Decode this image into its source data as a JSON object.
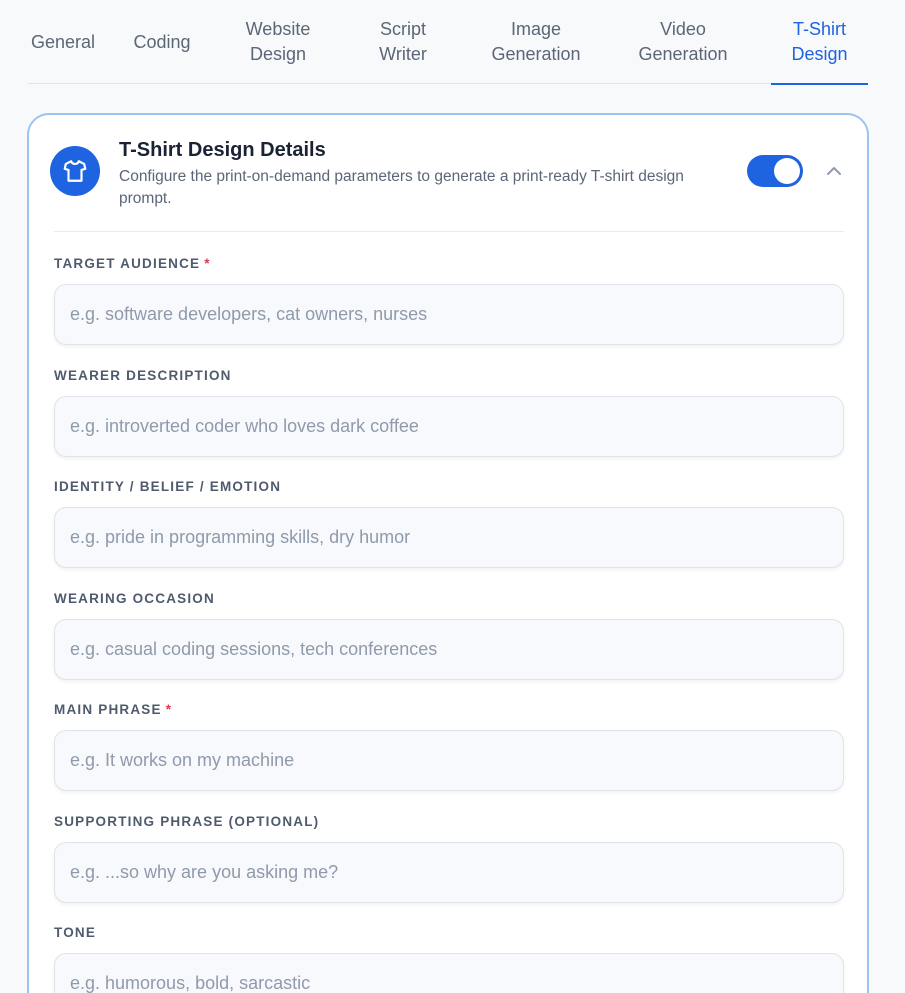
{
  "tabs": [
    {
      "label": "General"
    },
    {
      "label": "Coding"
    },
    {
      "label": "Website Design"
    },
    {
      "label": "Script Writer"
    },
    {
      "label": "Image Generation"
    },
    {
      "label": "Video Generation"
    },
    {
      "label": "T-Shirt Design",
      "active": true
    }
  ],
  "card": {
    "icon": "tshirt-icon",
    "title": "T-Shirt Design Details",
    "description": "Configure the print-on-demand parameters to generate a print-ready T-shirt design prompt.",
    "toggle_on": true,
    "collapse_icon": "chevron-up-icon"
  },
  "fields": {
    "target_audience": {
      "label": "TARGET AUDIENCE",
      "required_mark": "*",
      "placeholder": "e.g. software developers, cat owners, nurses"
    },
    "wearer_description": {
      "label": "WEARER DESCRIPTION",
      "placeholder": "e.g. introverted coder who loves dark coffee"
    },
    "identity_belief_emotion": {
      "label": "IDENTITY / BELIEF / EMOTION",
      "placeholder": "e.g. pride in programming skills, dry humor"
    },
    "wearing_occasion": {
      "label": "WEARING OCCASION",
      "placeholder": "e.g. casual coding sessions, tech conferences"
    },
    "main_phrase": {
      "label": "MAIN PHRASE",
      "required_mark": "*",
      "placeholder": "e.g. It works on my machine"
    },
    "supporting_phrase": {
      "label": "SUPPORTING PHRASE (OPTIONAL)",
      "placeholder": "e.g. ...so why are you asking me?"
    },
    "tone": {
      "label": "TONE",
      "placeholder": "e.g. humorous, bold, sarcastic"
    }
  },
  "colors": {
    "accent": "#1e63e0",
    "card_border": "#9cc4f1",
    "required": "#e0384a"
  }
}
